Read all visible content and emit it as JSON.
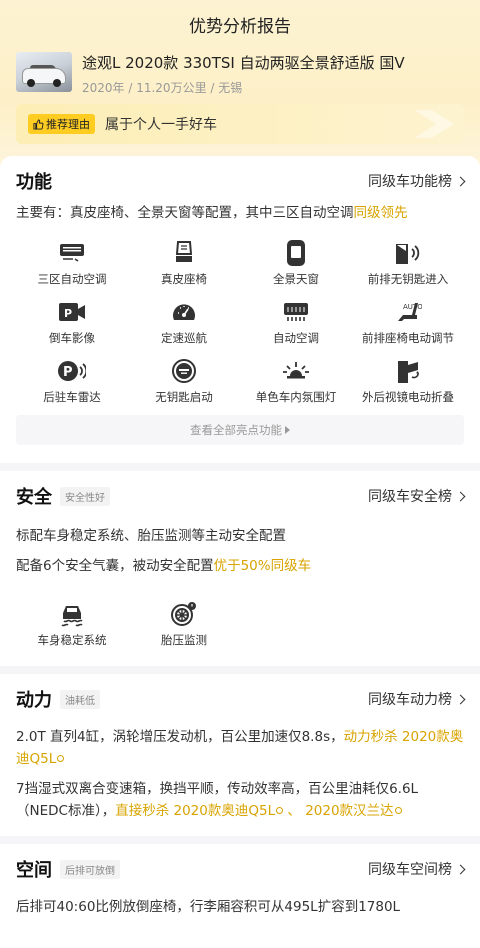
{
  "page_title": "优势分析报告",
  "car": {
    "name": "途观L 2020款 330TSI 自动两驱全景舒适版 国V",
    "meta": "2020年 / 11.20万公里 / 无锡"
  },
  "reason": {
    "tag": "推荐理由",
    "text": "属于个人一手好车"
  },
  "features": {
    "title": "功能",
    "link": "同级车功能榜",
    "desc_prefix": "主要有：真皮座椅、全景天窗等配置，其中三区自动空调",
    "desc_highlight": "同级领先",
    "items": [
      {
        "label": "三区自动空调",
        "icon": "ac-vent-icon"
      },
      {
        "label": "真皮座椅",
        "icon": "seat-icon"
      },
      {
        "label": "全景天窗",
        "icon": "sunroof-icon"
      },
      {
        "label": "前排无钥匙进入",
        "icon": "keyless-entry-icon"
      },
      {
        "label": "倒车影像",
        "icon": "reverse-camera-icon"
      },
      {
        "label": "定速巡航",
        "icon": "cruise-control-icon"
      },
      {
        "label": "自动空调",
        "icon": "auto-ac-icon"
      },
      {
        "label": "前排座椅电动调节",
        "icon": "power-seat-icon"
      },
      {
        "label": "后驻车雷达",
        "icon": "parking-radar-icon"
      },
      {
        "label": "无钥匙启动",
        "icon": "start-button-icon"
      },
      {
        "label": "单色车内氛围灯",
        "icon": "ambient-light-icon"
      },
      {
        "label": "外后视镜电动折叠",
        "icon": "mirror-fold-icon"
      }
    ],
    "view_all": "查看全部亮点功能"
  },
  "safety": {
    "title": "安全",
    "badge": "安全性好",
    "link": "同级车安全榜",
    "line1": "标配车身稳定系统、胎压监测等主动安全配置",
    "line2_prefix": "配备6个安全气囊，被动安全配置",
    "line2_highlight": "优于50%同级车",
    "items": [
      {
        "label": "车身稳定系统",
        "icon": "stability-control-icon"
      },
      {
        "label": "胎压监测",
        "icon": "tire-pressure-icon"
      }
    ]
  },
  "power": {
    "title": "动力",
    "badge": "油耗低",
    "link": "同级车动力榜",
    "p1_prefix": "2.0T 直列4缸，涡轮增压发动机，百公里加速仅8.8s，",
    "p1_hl": "动力秒杀 2020款奥迪Q5L",
    "p2_prefix": "7挡湿式双离合变速箱，换挡平顺，传动效率高，百公里油耗仅6.6L（NEDC标准），",
    "p2_hl1": "直接秒杀 2020款奥迪Q5L",
    "p2_sep": " 、 ",
    "p2_hl2": "2020款汉兰达"
  },
  "space": {
    "title": "空间",
    "badge": "后排可放倒",
    "link": "同级车空间榜",
    "desc": "后排可40:60比例放倒座椅，行李厢容积可从495L扩容到1780L"
  },
  "colors": {
    "accent": "#d8a400",
    "tag_yellow": "#ffcc22",
    "header_bg": "#fdf3d2"
  }
}
